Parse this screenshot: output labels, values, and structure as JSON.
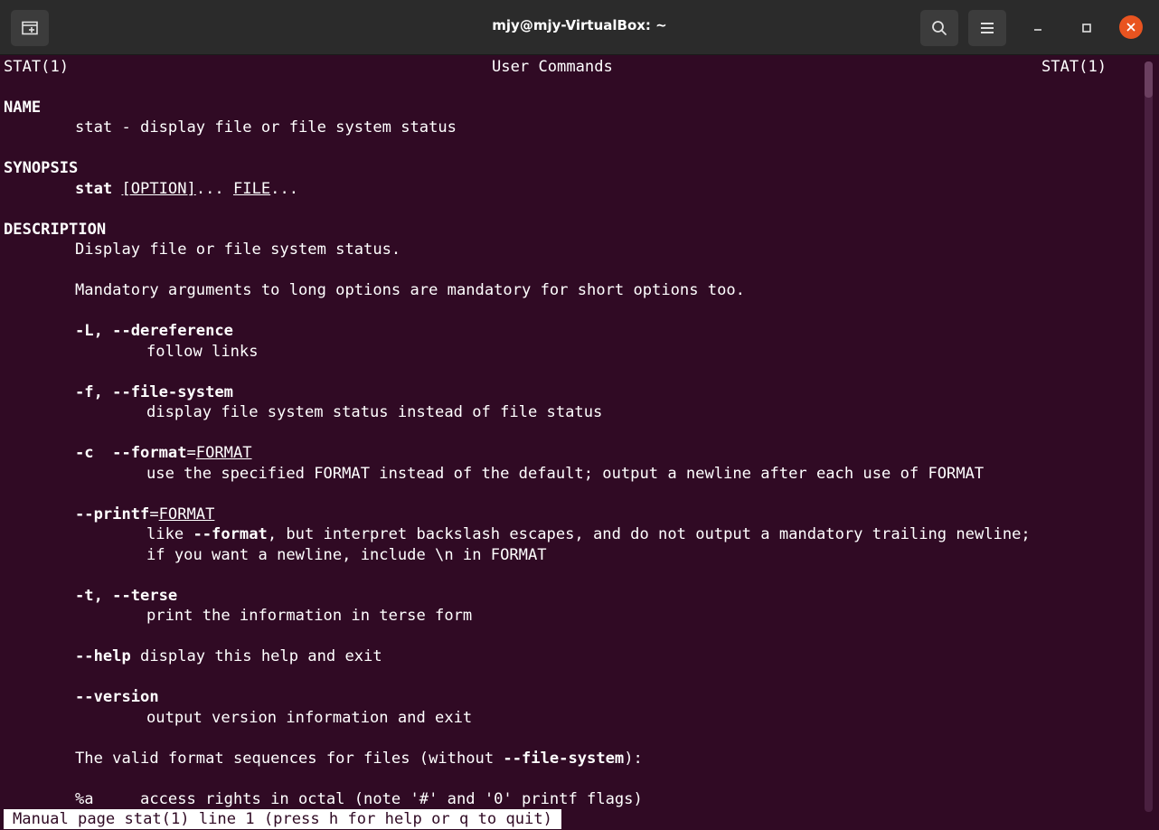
{
  "window": {
    "title": "mjy@mjy-VirtualBox: ~"
  },
  "icons": {
    "new_tab": "new-tab-icon",
    "search": "search-icon",
    "menu": "hamburger-menu-icon",
    "minimize": "minimize-icon",
    "maximize": "maximize-icon",
    "close": "close-icon"
  },
  "colors": {
    "terminal_bg": "#300a24",
    "titlebar_bg": "#2b2b2b",
    "close_button": "#e95420",
    "text": "#ffffff"
  },
  "man": {
    "header_left": "STAT(1)",
    "header_center": "User Commands",
    "header_right": "STAT(1)",
    "name_heading": "NAME",
    "name_text": "stat - display file or file system status",
    "synopsis_heading": "SYNOPSIS",
    "synopsis_cmd": "stat",
    "synopsis_option": "[OPTION]",
    "synopsis_mid": "... ",
    "synopsis_file": "FILE",
    "synopsis_end": "...",
    "description_heading": "DESCRIPTION",
    "desc_1": "Display file or file system status.",
    "desc_2": "Mandatory arguments to long options are mandatory for short options too.",
    "opt_L": "-L, --dereference",
    "opt_L_desc": "follow links",
    "opt_f": "-f, --file-system",
    "opt_f_desc": "display file system status instead of file status",
    "opt_c": "-c  --format",
    "opt_c_eq": "=",
    "opt_c_arg": "FORMAT",
    "opt_c_desc": "use the specified FORMAT instead of the default; output a newline after each use of FORMAT",
    "opt_printf": "--printf",
    "opt_printf_eq": "=",
    "opt_printf_arg": "FORMAT",
    "opt_printf_desc1_a": "like ",
    "opt_printf_desc1_b": "--format",
    "opt_printf_desc1_c": ", but interpret backslash escapes, and do not output a mandatory trailing newline;",
    "opt_printf_desc2": "if you want a newline, include \\n in FORMAT",
    "opt_t": "-t, --terse",
    "opt_t_desc": "print the information in terse form",
    "opt_help": "--help",
    "opt_help_desc": " display this help and exit",
    "opt_version": "--version",
    "opt_version_desc": "output version information and exit",
    "valid_a": "The valid format sequences for files (without ",
    "valid_b": "--file-system",
    "valid_c": "):",
    "seq_a": "%a     access rights in octal (note '#' and '0' printf flags)"
  },
  "status_bar": {
    "text": "Manual page stat(1) line 1 (press h for help or q to quit)"
  }
}
